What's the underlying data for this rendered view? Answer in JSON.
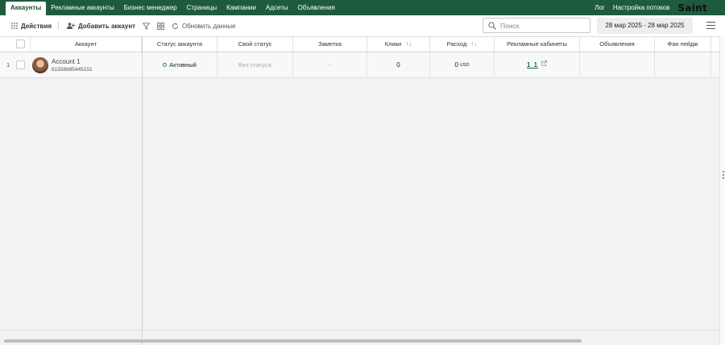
{
  "nav": {
    "tabs": [
      "Аккаунты",
      "Рекламные аккаунты",
      "Бизнес менеджер",
      "Страницы",
      "Кампании",
      "Адсеты",
      "Объявления"
    ],
    "active_tab": "Аккаунты",
    "log": "Лог",
    "flow_settings": "Настройка потоков",
    "logo": "Saint"
  },
  "toolbar": {
    "actions": "Действия",
    "add_account": "Добавить аккаунт",
    "refresh": "Обновить данные",
    "search_placeholder": "Поиск",
    "date_range": "28 мар 2025 - 28 мар 2025"
  },
  "table": {
    "columns": [
      "Аккаунт",
      "Статус аккаунта",
      "Свой статус",
      "Заметка",
      "Клики",
      "Расход",
      "Рекламные кабинеты",
      "Объявления",
      "Фан пейдж"
    ],
    "rows": [
      {
        "index": "1",
        "name": "Account 1",
        "id": "61558685445151",
        "status": "Активный",
        "own_status": "Без статуса",
        "note": "-",
        "clicks": "0",
        "spend": "0",
        "currency": "USD",
        "ad_cabinets": "1 1",
        "ads": "",
        "fan_page": ""
      }
    ]
  },
  "colors": {
    "nav_bg": "#1e5b3e",
    "status_active": "#2e8b57",
    "link": "#1e6b46"
  }
}
